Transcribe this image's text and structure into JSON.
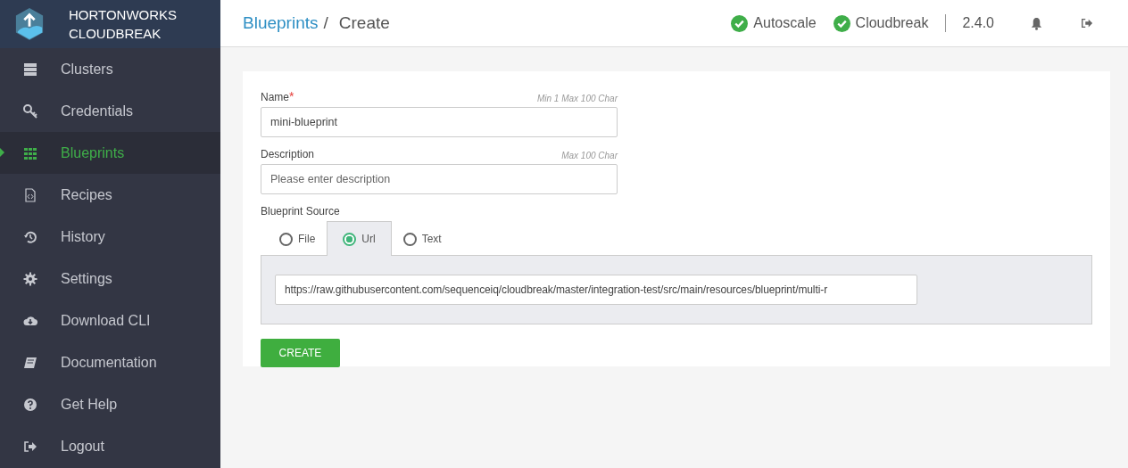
{
  "brand": {
    "line1": "HORTONWORKS",
    "line2": "CLOUDBREAK"
  },
  "sidebar": {
    "items": [
      {
        "label": "Clusters",
        "kind": "clusters",
        "selected": false
      },
      {
        "label": "Credentials",
        "kind": "credentials",
        "selected": false
      },
      {
        "label": "Blueprints",
        "kind": "blueprints",
        "selected": true
      },
      {
        "label": "Recipes",
        "kind": "recipes",
        "selected": false
      },
      {
        "label": "History",
        "kind": "history",
        "selected": false
      },
      {
        "label": "Settings",
        "kind": "settings",
        "selected": false
      },
      {
        "label": "Download CLI",
        "kind": "download",
        "selected": false
      },
      {
        "label": "Documentation",
        "kind": "documentation",
        "selected": false
      },
      {
        "label": "Get Help",
        "kind": "help",
        "selected": false
      },
      {
        "label": "Logout",
        "kind": "logout",
        "selected": false
      }
    ]
  },
  "breadcrumb": {
    "link": "Blueprints",
    "separator": "/",
    "current": "Create"
  },
  "header": {
    "statuses": [
      {
        "label": "Autoscale",
        "ok": true
      },
      {
        "label": "Cloudbreak",
        "ok": true
      }
    ],
    "version": "2.4.0"
  },
  "form": {
    "name": {
      "label": "Name",
      "required_mark": "*",
      "hint": "Min 1 Max 100 Char",
      "value": "mini-blueprint"
    },
    "description": {
      "label": "Description",
      "hint": "Max 100 Char",
      "placeholder": "Please enter description"
    },
    "source": {
      "label": "Blueprint Source",
      "tabs": [
        {
          "label": "File",
          "selected": false
        },
        {
          "label": "Url",
          "selected": true
        },
        {
          "label": "Text",
          "selected": false
        }
      ],
      "url": "https://raw.githubusercontent.com/sequenceiq/cloudbreak/master/integration-test/src/main/resources/blueprint/multi-r"
    },
    "submit": "CREATE"
  }
}
